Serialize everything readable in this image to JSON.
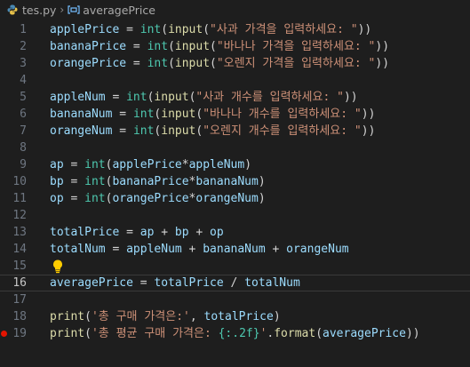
{
  "breadcrumb": {
    "file_name": "tes.py",
    "separator": "›",
    "symbol_name": "averagePrice"
  },
  "colors": {
    "background": "#1e1e1e",
    "variable": "#9cdcfe",
    "function": "#dcdcaa",
    "builtin": "#4ec9b0",
    "string": "#ce9178",
    "operator": "#d4d4d4",
    "line_number": "#6e7681",
    "breakpoint": "#e51400",
    "bulb": "#ffcc00"
  },
  "icons": {
    "file": "python-icon",
    "symbol": "variable-icon",
    "hint": "lightbulb-icon",
    "breakpoint": "breakpoint-icon"
  },
  "editor": {
    "active_line": 16,
    "lines": [
      {
        "n": "1",
        "tokens": [
          [
            "var",
            "applePrice"
          ],
          [
            "op",
            " = "
          ],
          [
            "bi",
            "int"
          ],
          [
            "op",
            "("
          ],
          [
            "fn",
            "input"
          ],
          [
            "op",
            "("
          ],
          [
            "str",
            "\"사과 가격을 입력하세요: \""
          ],
          [
            "op",
            "))"
          ]
        ]
      },
      {
        "n": "2",
        "tokens": [
          [
            "var",
            "bananaPrice"
          ],
          [
            "op",
            " = "
          ],
          [
            "bi",
            "int"
          ],
          [
            "op",
            "("
          ],
          [
            "fn",
            "input"
          ],
          [
            "op",
            "("
          ],
          [
            "str",
            "\"바나나 가격을 입력하세요: \""
          ],
          [
            "op",
            "))"
          ]
        ]
      },
      {
        "n": "3",
        "tokens": [
          [
            "var",
            "orangePrice"
          ],
          [
            "op",
            " = "
          ],
          [
            "bi",
            "int"
          ],
          [
            "op",
            "("
          ],
          [
            "fn",
            "input"
          ],
          [
            "op",
            "("
          ],
          [
            "str",
            "\"오렌지 가격을 입력하세요: \""
          ],
          [
            "op",
            "))"
          ]
        ]
      },
      {
        "n": "4",
        "tokens": []
      },
      {
        "n": "5",
        "tokens": [
          [
            "var",
            "appleNum"
          ],
          [
            "op",
            " = "
          ],
          [
            "bi",
            "int"
          ],
          [
            "op",
            "("
          ],
          [
            "fn",
            "input"
          ],
          [
            "op",
            "("
          ],
          [
            "str",
            "\"사과 개수를 입력하세요: \""
          ],
          [
            "op",
            "))"
          ]
        ]
      },
      {
        "n": "6",
        "tokens": [
          [
            "var",
            "bananaNum"
          ],
          [
            "op",
            " = "
          ],
          [
            "bi",
            "int"
          ],
          [
            "op",
            "("
          ],
          [
            "fn",
            "input"
          ],
          [
            "op",
            "("
          ],
          [
            "str",
            "\"바나나 개수를 입력하세요: \""
          ],
          [
            "op",
            "))"
          ]
        ]
      },
      {
        "n": "7",
        "tokens": [
          [
            "var",
            "orangeNum"
          ],
          [
            "op",
            " = "
          ],
          [
            "bi",
            "int"
          ],
          [
            "op",
            "("
          ],
          [
            "fn",
            "input"
          ],
          [
            "op",
            "("
          ],
          [
            "str",
            "\"오렌지 개수를 입력하세요: \""
          ],
          [
            "op",
            "))"
          ]
        ]
      },
      {
        "n": "8",
        "tokens": []
      },
      {
        "n": "9",
        "tokens": [
          [
            "var",
            "ap"
          ],
          [
            "op",
            " = "
          ],
          [
            "bi",
            "int"
          ],
          [
            "op",
            "("
          ],
          [
            "var",
            "applePrice"
          ],
          [
            "op",
            "*"
          ],
          [
            "var",
            "appleNum"
          ],
          [
            "op",
            ")"
          ]
        ]
      },
      {
        "n": "10",
        "tokens": [
          [
            "var",
            "bp"
          ],
          [
            "op",
            " = "
          ],
          [
            "bi",
            "int"
          ],
          [
            "op",
            "("
          ],
          [
            "var",
            "bananaPrice"
          ],
          [
            "op",
            "*"
          ],
          [
            "var",
            "bananaNum"
          ],
          [
            "op",
            ")"
          ]
        ]
      },
      {
        "n": "11",
        "tokens": [
          [
            "var",
            "op"
          ],
          [
            "op",
            " = "
          ],
          [
            "bi",
            "int"
          ],
          [
            "op",
            "("
          ],
          [
            "var",
            "orangePrice"
          ],
          [
            "op",
            "*"
          ],
          [
            "var",
            "orangeNum"
          ],
          [
            "op",
            ")"
          ]
        ]
      },
      {
        "n": "12",
        "tokens": []
      },
      {
        "n": "13",
        "tokens": [
          [
            "var",
            "totalPrice"
          ],
          [
            "op",
            " = "
          ],
          [
            "var",
            "ap"
          ],
          [
            "op",
            " + "
          ],
          [
            "var",
            "bp"
          ],
          [
            "op",
            " + "
          ],
          [
            "var",
            "op"
          ]
        ]
      },
      {
        "n": "14",
        "tokens": [
          [
            "var",
            "totalNum"
          ],
          [
            "op",
            " = "
          ],
          [
            "var",
            "appleNum"
          ],
          [
            "op",
            " + "
          ],
          [
            "var",
            "bananaNum"
          ],
          [
            "op",
            " + "
          ],
          [
            "var",
            "orangeNum"
          ]
        ]
      },
      {
        "n": "15",
        "tokens": []
      },
      {
        "n": "16",
        "tokens": [
          [
            "var",
            "averagePrice"
          ],
          [
            "op",
            " = "
          ],
          [
            "var",
            "totalPrice"
          ],
          [
            "op",
            " / "
          ],
          [
            "var",
            "totalNum"
          ]
        ]
      },
      {
        "n": "17",
        "tokens": []
      },
      {
        "n": "18",
        "tokens": [
          [
            "fn",
            "print"
          ],
          [
            "op",
            "("
          ],
          [
            "str",
            "'총 구매 가격은:'"
          ],
          [
            "op",
            ", "
          ],
          [
            "var",
            "totalPrice"
          ],
          [
            "op",
            ")"
          ]
        ]
      },
      {
        "n": "19",
        "tokens": [
          [
            "fn",
            "print"
          ],
          [
            "op",
            "("
          ],
          [
            "str",
            "'총 평균 구매 가격은: "
          ],
          [
            "bi",
            "{:.2f}"
          ],
          [
            "str",
            "'"
          ],
          [
            "op",
            "."
          ],
          [
            "fn",
            "format"
          ],
          [
            "op",
            "("
          ],
          [
            "var",
            "averagePrice"
          ],
          [
            "op",
            "))"
          ]
        ]
      }
    ]
  }
}
